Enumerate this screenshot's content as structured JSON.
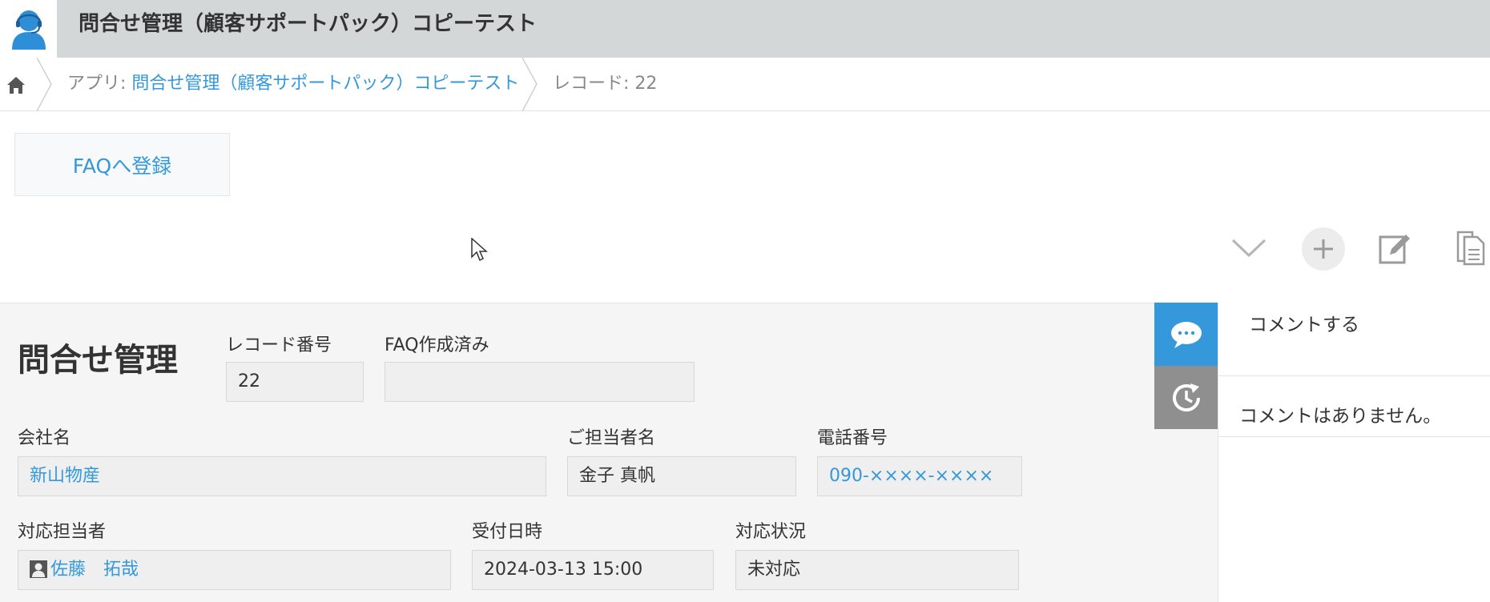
{
  "header": {
    "title": "問合せ管理（顧客サポートパック）コピーテスト",
    "icon": "support-person-icon"
  },
  "breadcrumb": {
    "app_prefix": "アプリ: ",
    "app_name": "問合せ管理（顧客サポートパック）コピーテスト",
    "record": "レコード: 22"
  },
  "actions": {
    "faq_button": "FAQへ登録"
  },
  "record": {
    "form_title": "問合せ管理",
    "fields": {
      "record_number": {
        "label": "レコード番号",
        "value": "22"
      },
      "faq_created": {
        "label": "FAQ作成済み",
        "value": ""
      },
      "company": {
        "label": "会社名",
        "value": "新山物産"
      },
      "contact_person": {
        "label": "ご担当者名",
        "value": "金子 真帆"
      },
      "phone": {
        "label": "電話番号",
        "value": "090-××××-××××"
      },
      "assignee": {
        "label": "対応担当者",
        "value": "佐藤　拓哉"
      },
      "received_at": {
        "label": "受付日時",
        "value": "2024-03-13 15:00"
      },
      "status": {
        "label": "対応状況",
        "value": "未対応"
      }
    }
  },
  "comments": {
    "input_placeholder": "コメントする",
    "empty_message": "コメントはありません。"
  },
  "colors": {
    "accent": "#3498db",
    "header_bg": "#d4d7d8",
    "history_tab": "#8f8f8f"
  }
}
